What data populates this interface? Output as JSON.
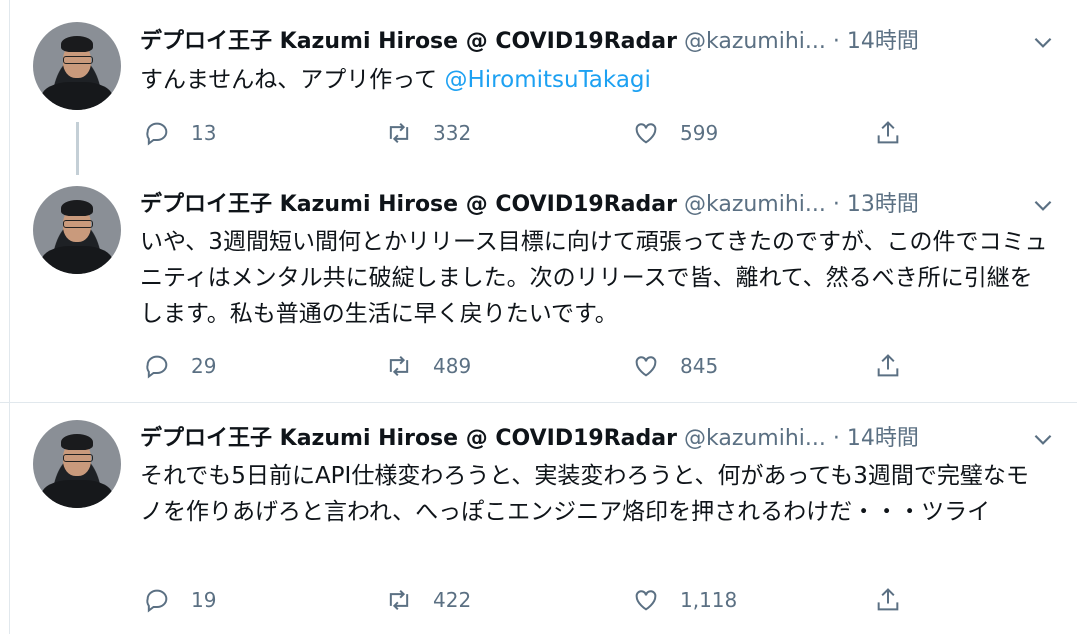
{
  "tweets": [
    {
      "display_name": "デプロイ王子 Kazumi Hirose @ COVID19Radar",
      "handle": "@kazumihi...",
      "dot": "·",
      "time": "14時間",
      "text_prefix": "すんませんね、アプリ作って ",
      "mention": "@HiromitsuTakagi",
      "replies": "13",
      "retweets": "332",
      "likes": "599"
    },
    {
      "display_name": "デプロイ王子 Kazumi Hirose @ COVID19Radar",
      "handle": "@kazumihi...",
      "dot": "·",
      "time": "13時間",
      "text": "いや、3週間短い間何とかリリース目標に向けて頑張ってきたのですが、この件でコミュニティはメンタル共に破綻しました。次のリリースで皆、離れて、然るべき所に引継をします。私も普通の生活に早く戻りたいです。",
      "replies": "29",
      "retweets": "489",
      "likes": "845"
    },
    {
      "display_name": "デプロイ王子 Kazumi Hirose @ COVID19Radar",
      "handle": "@kazumihi...",
      "dot": "·",
      "time": "14時間",
      "text": "それでも5日前にAPI仕様変わろうと、実装変わろうと、何があっても3週間で完璧なモノを作りあげろと言われ、へっぽこエンジニア烙印を押されるわけだ・・・ツライ",
      "replies": "19",
      "retweets": "422",
      "likes": "1,118"
    }
  ],
  "colors": {
    "text": "#0f1419",
    "muted": "#5b7083",
    "link": "#1da1f2",
    "divider": "#e1e8ed"
  },
  "icons": [
    "reply-icon",
    "retweet-icon",
    "like-icon",
    "share-icon",
    "chevron-down-icon"
  ]
}
